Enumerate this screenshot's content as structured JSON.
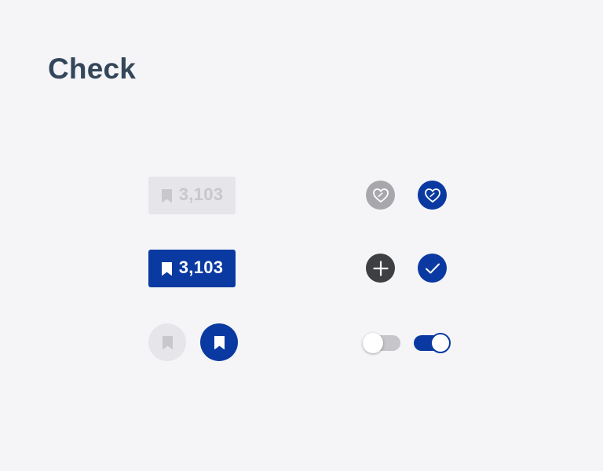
{
  "page": {
    "title": "Check"
  },
  "bookmark_buttons": [
    {
      "state": "inactive",
      "icon": "bookmark-icon",
      "count": "3,103"
    },
    {
      "state": "active",
      "icon": "bookmark-icon",
      "count": "3,103"
    }
  ],
  "round_bookmarks": [
    {
      "state": "inactive",
      "icon": "bookmark-icon"
    },
    {
      "state": "active",
      "icon": "bookmark-icon"
    }
  ],
  "actions": [
    {
      "name": "like",
      "state": "inactive",
      "icon": "heart-icon"
    },
    {
      "name": "like",
      "state": "active",
      "icon": "heart-icon"
    },
    {
      "name": "add",
      "icon": "plus-icon"
    },
    {
      "name": "check",
      "icon": "check-icon"
    }
  ],
  "toggles": [
    {
      "state": "off"
    },
    {
      "state": "on"
    }
  ],
  "colors": {
    "background": "#f5f5f8",
    "title": "#34475a",
    "brand": "#0a3aa1",
    "inactive_bg": "#e6e6ea",
    "inactive_fg": "#c7c7cc",
    "inactive_icon_bg": "#a8a8ac",
    "dark_icon_bg": "#3e3f42",
    "toggle_off_track": "#c6c6cb"
  }
}
